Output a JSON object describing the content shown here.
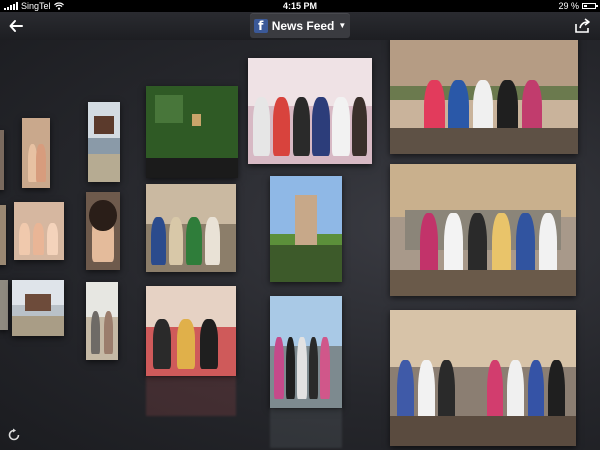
{
  "status_bar": {
    "carrier": "SingTel",
    "time": "4:15 PM",
    "battery": "29 %",
    "battery_level": 0.29
  },
  "nav": {
    "title": "News Feed",
    "back_icon": "back-arrow-icon",
    "share_icon": "share-icon",
    "dropdown_icon": "chevron-down-icon"
  },
  "footer": {
    "refresh_icon": "refresh-icon"
  },
  "colors": {
    "facebook_blue": "#3b5998",
    "background": "#222328"
  }
}
